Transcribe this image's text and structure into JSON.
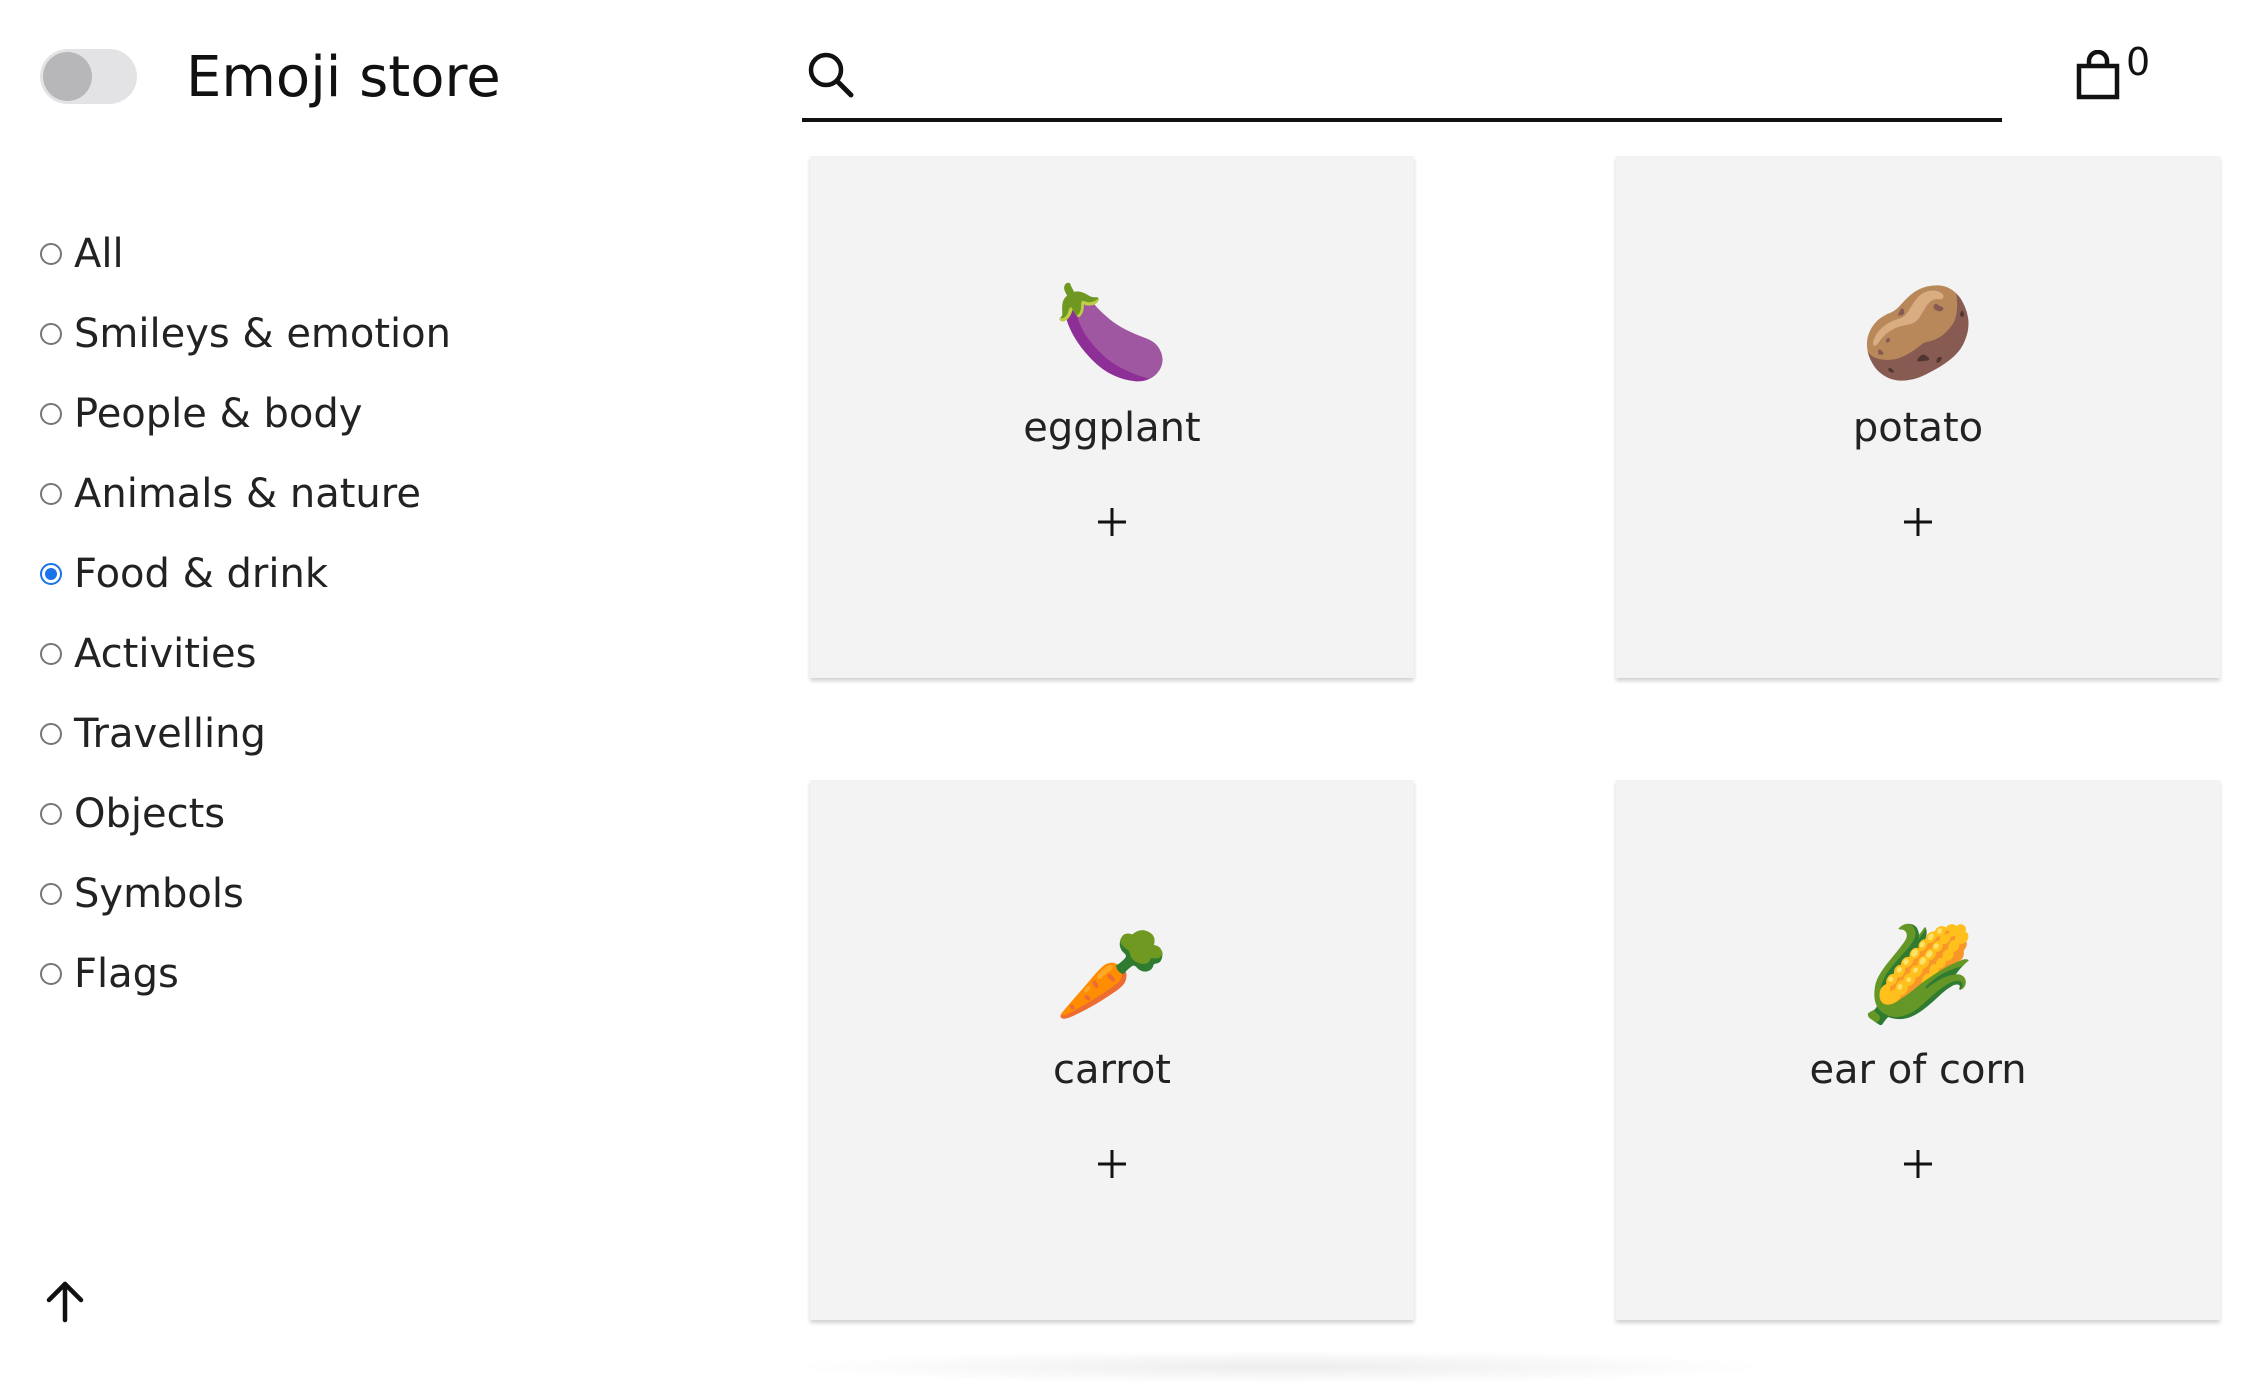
{
  "header": {
    "theme_toggle_state": "off",
    "title": "Emoji store",
    "search": {
      "value": "",
      "placeholder": ""
    },
    "cart": {
      "count": "0"
    }
  },
  "sidebar": {
    "categories": [
      {
        "label": "All",
        "selected": false
      },
      {
        "label": "Smileys & emotion",
        "selected": false
      },
      {
        "label": "People & body",
        "selected": false
      },
      {
        "label": "Animals & nature",
        "selected": false
      },
      {
        "label": "Food & drink",
        "selected": true
      },
      {
        "label": "Activities",
        "selected": false
      },
      {
        "label": "Travelling",
        "selected": false
      },
      {
        "label": "Objects",
        "selected": false
      },
      {
        "label": "Symbols",
        "selected": false
      },
      {
        "label": "Flags",
        "selected": false
      }
    ],
    "back_to_top_icon": "arrow-up-icon"
  },
  "products": [
    {
      "emoji": "🍆",
      "name": "eggplant"
    },
    {
      "emoji": "🥔",
      "name": "potato"
    },
    {
      "emoji": "🥕",
      "name": "carrot"
    },
    {
      "emoji": "🌽",
      "name": "ear of corn"
    }
  ],
  "colors": {
    "accent": "#1a73e8",
    "card_background": "#f3f3f3",
    "text": "#222222"
  }
}
